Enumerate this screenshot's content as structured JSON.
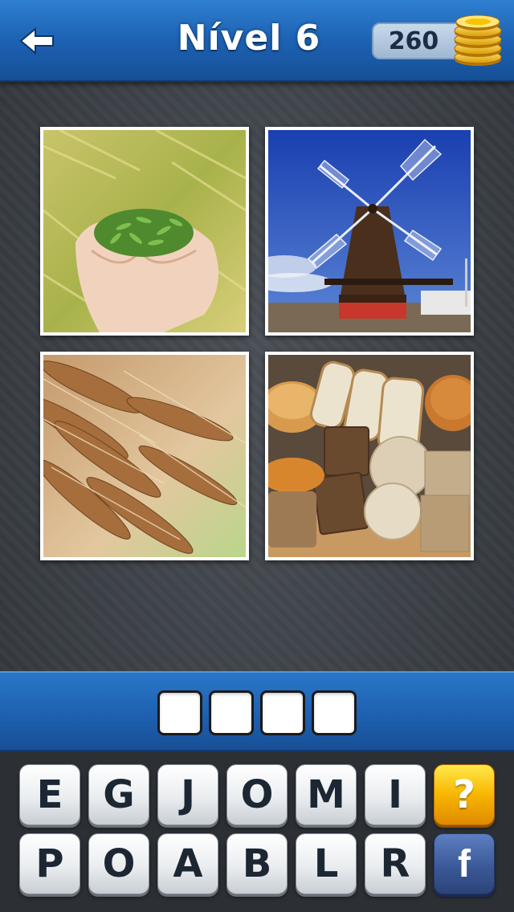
{
  "header": {
    "title": "Nível 6",
    "coins": "260"
  },
  "pictures": [
    {
      "name": "hands-holding-grain"
    },
    {
      "name": "windmill"
    },
    {
      "name": "wheat-ears"
    },
    {
      "name": "bread-assortment"
    }
  ],
  "answer": {
    "slots": [
      "",
      "",
      "",
      ""
    ]
  },
  "keyboard": {
    "row1": [
      "E",
      "G",
      "J",
      "O",
      "M",
      "I"
    ],
    "row2": [
      "P",
      "O",
      "A",
      "B",
      "L",
      "R"
    ],
    "hint_label": "?",
    "facebook_label": "f"
  },
  "colors": {
    "header_blue": "#1d62b3",
    "hint_yellow": "#f7b600",
    "facebook_blue": "#3b5998"
  }
}
